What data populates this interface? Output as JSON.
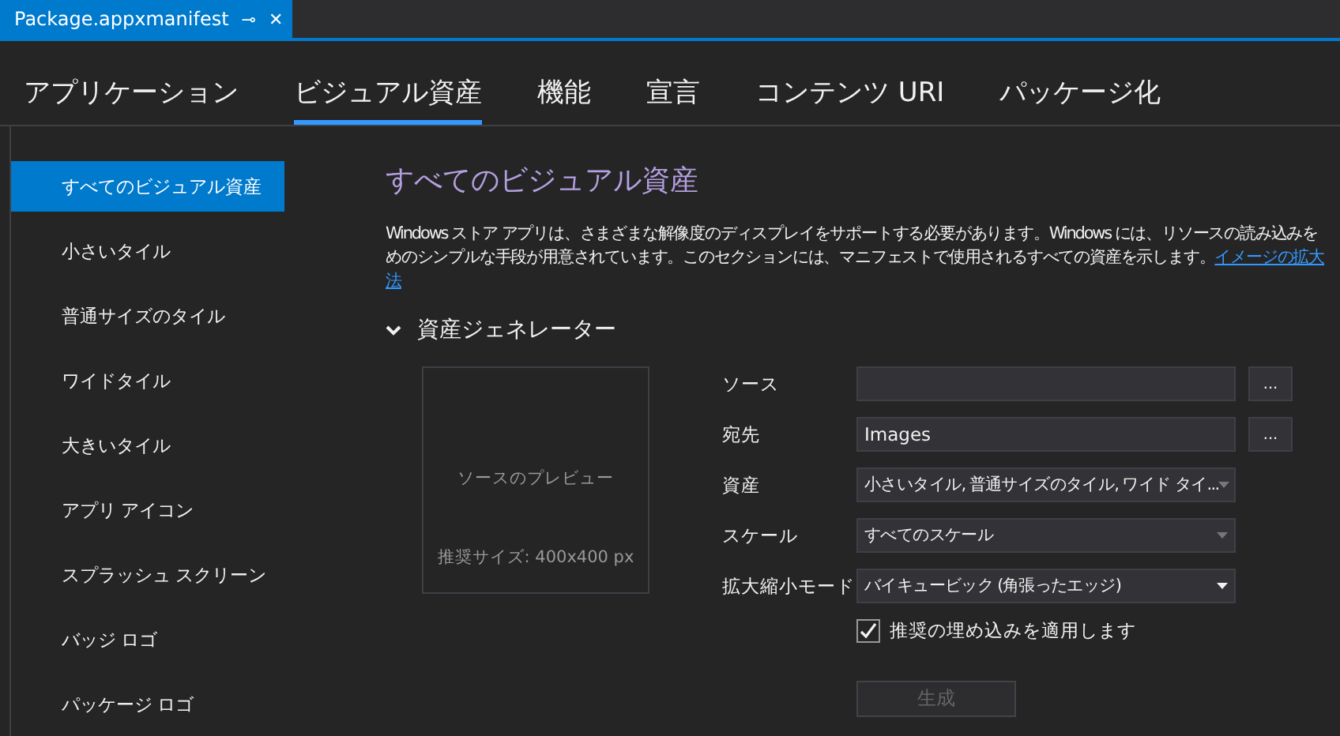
{
  "document_tab": {
    "title": "Package.appxmanifest",
    "pin": "⊸",
    "close": "✕"
  },
  "tabs": [
    {
      "label": "アプリケーション",
      "selected": false
    },
    {
      "label": "ビジュアル資産",
      "selected": true
    },
    {
      "label": "機能",
      "selected": false
    },
    {
      "label": "宣言",
      "selected": false
    },
    {
      "label": "コンテンツ URI",
      "selected": false
    },
    {
      "label": "パッケージ化",
      "selected": false
    }
  ],
  "sidebar": {
    "items": [
      {
        "label": "すべてのビジュアル資産",
        "selected": true
      },
      {
        "label": "小さいタイル",
        "selected": false
      },
      {
        "label": "普通サイズのタイル",
        "selected": false
      },
      {
        "label": "ワイドタイル",
        "selected": false
      },
      {
        "label": "大きいタイル",
        "selected": false
      },
      {
        "label": "アプリ アイコン",
        "selected": false
      },
      {
        "label": "スプラッシュ スクリーン",
        "selected": false
      },
      {
        "label": "バッジ ロゴ",
        "selected": false
      },
      {
        "label": "パッケージ ロゴ",
        "selected": false
      }
    ]
  },
  "content": {
    "title": "すべてのビジュアル資産",
    "description": [
      {
        "text": "Windows ストア アプリは、さまざまな解像度のディスプレイをサポートする必要があります。Windows には、リソースの読み込みを"
      },
      {
        "text": "めのシンプルな手段が用意されています。このセクションには、マニフェストで使用されるすべての資産を示します。",
        "link": "イメージの拡大"
      },
      {
        "link": "法"
      }
    ],
    "section": {
      "title": "資産ジェネレーター",
      "expanded": true,
      "preview": {
        "label": "ソースのプレビュー",
        "hint": "推奨サイズ: 400x400 px"
      },
      "fields": [
        {
          "kind": "browse",
          "label": "ソース",
          "browse": "..."
        },
        {
          "kind": "browse",
          "label": "宛先",
          "value": "Images",
          "browse": "..."
        },
        {
          "kind": "dropdown",
          "label": "資産",
          "value": "小さいタイル, 普通サイズのタイル, ワイド タイ...",
          "disabled": true
        },
        {
          "kind": "dropdown",
          "label": "スケール",
          "value": "すべてのスケール",
          "disabled": true
        },
        {
          "kind": "dropdown",
          "label": "拡大縮小モード",
          "value": "バイキュービック (角張ったエッジ)",
          "disabled": false
        }
      ],
      "checkbox": {
        "label": "推奨の埋め込みを適用します",
        "checked": true
      },
      "generate": {
        "label": "生成",
        "disabled": true
      }
    }
  }
}
